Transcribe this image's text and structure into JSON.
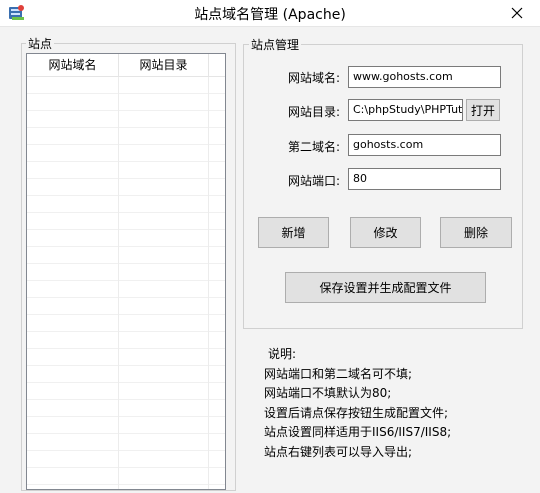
{
  "window": {
    "title": "站点域名管理 (Apache)",
    "icon": "app-icon",
    "close_glyph": "✕"
  },
  "sites_panel": {
    "legend": "站点",
    "columns": [
      "网站域名",
      "网站目录"
    ]
  },
  "settings_panel": {
    "legend": "站点管理",
    "domain_label": "网站域名:",
    "domain_value": "www.gohosts.com",
    "dir_label": "网站目录:",
    "dir_value": "C:\\phpStudy\\PHPTutorial\\WWW",
    "open_button": "打开",
    "second_domain_label": "第二域名:",
    "second_domain_value": "gohosts.com",
    "port_label": "网站端口:",
    "port_value": "80",
    "add_button": "新增",
    "edit_button": "修改",
    "delete_button": "删除",
    "save_button": "保存设置并生成配置文件"
  },
  "notes": {
    "heading": "说明:",
    "lines": [
      "网站端口和第二域名可不填;",
      "网站端口不填默认为80;",
      "设置后请点保存按钮生成配置文件;",
      "站点设置同样适用于IIS6/IIS7/IIS8;",
      "站点右键列表可以导入导出;"
    ]
  }
}
